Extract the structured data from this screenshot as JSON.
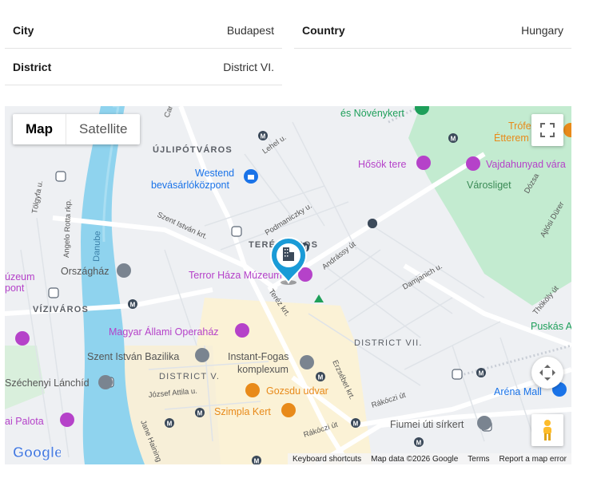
{
  "details": {
    "city_label": "City",
    "city_value": "Budapest",
    "country_label": "Country",
    "country_value": "Hungary",
    "district_label": "District",
    "district_value": "District VI."
  },
  "map": {
    "map_type_map": "Map",
    "map_type_satellite": "Satellite",
    "areas": {
      "ujlipotvaros": "ÚJLIPÓTVÁROS",
      "terezvaros": "TERÉZVÁROS",
      "vizivaros": "VÍZIVÁROS",
      "district_v": "DISTRICT V.",
      "district_vii": "DISTRICT VII."
    },
    "pois": {
      "novenykert": "és Növénykert",
      "trofea": "Trófe",
      "etterem": "Étterem",
      "westend1": "Westend",
      "westend2": "bevásárlóközpont",
      "hosok": "Hősök tere",
      "vajdahunyad": "Vajdahunyad vára",
      "varosliget": "Városliget",
      "terror": "Terror Háza Múzeum",
      "muzeum": "úzeum",
      "pont": "pont",
      "orszaghaz": "Országház",
      "opera": "Magyar Állami Operaház",
      "bazilika": "Szent István Bazilika",
      "instant1": "Instant-Fogas",
      "instant2": "komplexum",
      "lanchid": "Széchenyi Lánchíd",
      "gozsdu": "Gozsdu udvar",
      "szimpla": "Szimpla Kert",
      "arena": "Aréna Mall",
      "fiumei": "Fiumei úti sírkert",
      "palota": "ai Palota",
      "puskas": "Puskás A"
    },
    "streets": {
      "szent_istvan": "Szent István krt.",
      "podmaniczky": "Podmaniczky u.",
      "andrassy": "Andrássy út",
      "terez": "Teréz krt.",
      "erzsebet": "Erzsébet krt.",
      "rakoczi1": "Rákóczi út",
      "rakoczi2": "Rákóczi út",
      "jozsef_attila": "József Attila u.",
      "jane_haining": "Jane Haining",
      "damjanich": "Damjanich u.",
      "thokoly": "Thököly út",
      "ajtosi": "Ajtósi Dürer",
      "dozsa": "Dózsa",
      "lehel": "Lehel u.",
      "angelo_rotta": "Angelo Rotta rkp.",
      "tolgyfa": "Tölgyfa u.",
      "danube": "Danube",
      "car": "Car"
    },
    "footer": {
      "shortcuts": "Keyboard shortcuts",
      "mapdata": "Map data ©2026 Google",
      "terms": "Terms",
      "report": "Report a map error"
    },
    "logo": "Google",
    "colors": {
      "water": "#8fd3ee",
      "park": "#c3ebd0",
      "marker": "#1a9bd7",
      "poi_purple": "#b542c9",
      "poi_orange": "#e88a1a",
      "metro": "#3c4a5a"
    },
    "pin_icon": "building-icon"
  }
}
